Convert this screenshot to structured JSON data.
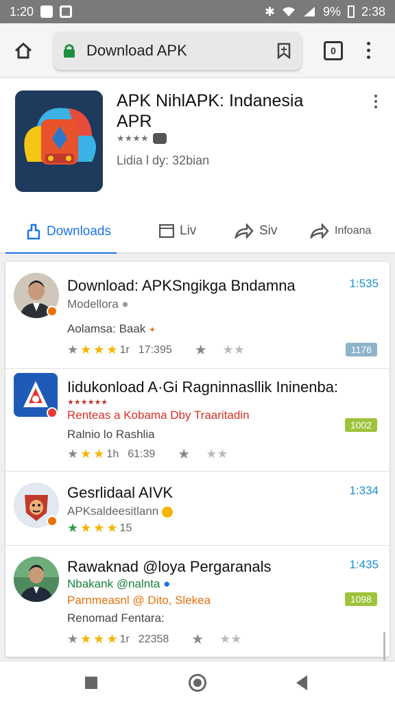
{
  "status": {
    "time_left": "1:20",
    "battery": "9%",
    "time_right": "2:38"
  },
  "browser": {
    "url": "Download APK",
    "tabs_count": "0"
  },
  "app": {
    "title": "APK NihlAPK: Indanesia APR",
    "subtitle": "Lidia l dy: 32bian"
  },
  "tabs": [
    {
      "label": "Downloads",
      "icon": "download-icon"
    },
    {
      "label": "Liv",
      "icon": "window-icon"
    },
    {
      "label": "Siv",
      "icon": "share-icon"
    },
    {
      "label": "Infoana",
      "icon": "share-icon"
    }
  ],
  "items": [
    {
      "title": "Download: APKSngikga Bndamna",
      "time": "1:535",
      "sub": "Modellora",
      "line": "Aolamsa: Baak",
      "stars_label": "1r",
      "stars_count": "17:395",
      "badge": "1176",
      "badge_color": "#8fb3c9"
    },
    {
      "title": "Iidukonload A·Gi Ragninnasllik Ininenba:",
      "time": "",
      "sub": "Renteas a Kobama Dby Traaritadin",
      "line": "Ralnio lo Rashlia",
      "stars_label": "1h",
      "stars_count": "61:39",
      "badge": "1002",
      "badge_color": "#9dc33b"
    },
    {
      "title": "Gesrlidaal AIVK",
      "time": "1:334",
      "sub": "APKsaldeesitlann",
      "stars_label": "15"
    },
    {
      "title": "Rawaknad @loya Pergaranals",
      "time": "1:435",
      "sub": "Nbakank @nalnta",
      "sub2": "Parnmeasnl @ Dito, Slekea",
      "line": "Renomad Fentara:",
      "stars_label": "1r",
      "stars_count": "22358",
      "badge": "1098",
      "badge_color": "#9dc33b"
    }
  ]
}
